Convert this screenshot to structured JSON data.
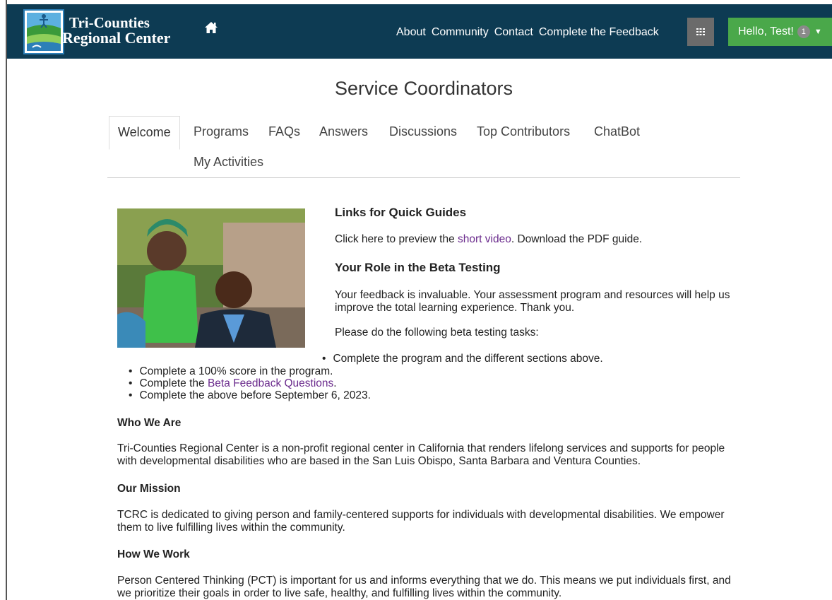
{
  "brand": {
    "line1": "Tri-Counties",
    "line2": "Regional Center",
    "logo_icon": "tri-counties-logo-icon"
  },
  "nav": {
    "home_icon": "home-icon",
    "links": [
      "About",
      "Community",
      "Contact",
      "Complete the Feedback"
    ],
    "grid_icon": "grid-icon",
    "user_greeting": "Hello, Test!",
    "notification_count": "1",
    "colors": {
      "navbar": "#0d3b53",
      "user_button": "#4aa84a",
      "grid_button": "#6b6b6b"
    }
  },
  "page": {
    "title": "Service Coordinators"
  },
  "tabs": [
    "Welcome",
    "Programs",
    "FAQs",
    "Answers",
    "Discussions",
    "Top Contributors",
    "ChatBot",
    "My Activities"
  ],
  "content": {
    "links_heading": "Links for Quick Guides",
    "preview_prefix": "Click here to preview the ",
    "short_video_link": "short video",
    "download_prefix": ". Download the ",
    "pdf_link": "PDF guide.",
    "role_heading": "Your Role in the Beta Testing",
    "role_text": "Your feedback is invaluable. Your assessment program and resources will help us improve the total learning experience. Thank you.",
    "tasks_intro": "Please do the following beta testing tasks:",
    "task_1": "Complete the program and the different sections above.",
    "task_2": "Complete a 100% score in the program.",
    "task_3_prefix": "Complete the ",
    "task_3_link": "Beta Feedback Questions",
    "task_3_suffix": ".",
    "task_4": "Complete the above before September 6, 2023.",
    "who_heading": "Who We Are",
    "who_text": "Tri-Counties Regional Center is a non-profit regional center in California that renders lifelong services and supports for people with developmental disabilities who are based in the San Luis Obispo, Santa Barbara and Ventura Counties.",
    "mission_heading": "Our Mission",
    "mission_text": "TCRC is dedicated to giving person and family-centered supports for individuals with developmental disabilities. We empower them to live fulfilling lives within the community.",
    "work_heading": "How We Work",
    "work_text": "Person Centered Thinking (PCT) is important for us and informs everything that we do. This means we put individuals first, and we prioritize their goals in order to live safe, healthy, and fulfilling lives within the community."
  }
}
